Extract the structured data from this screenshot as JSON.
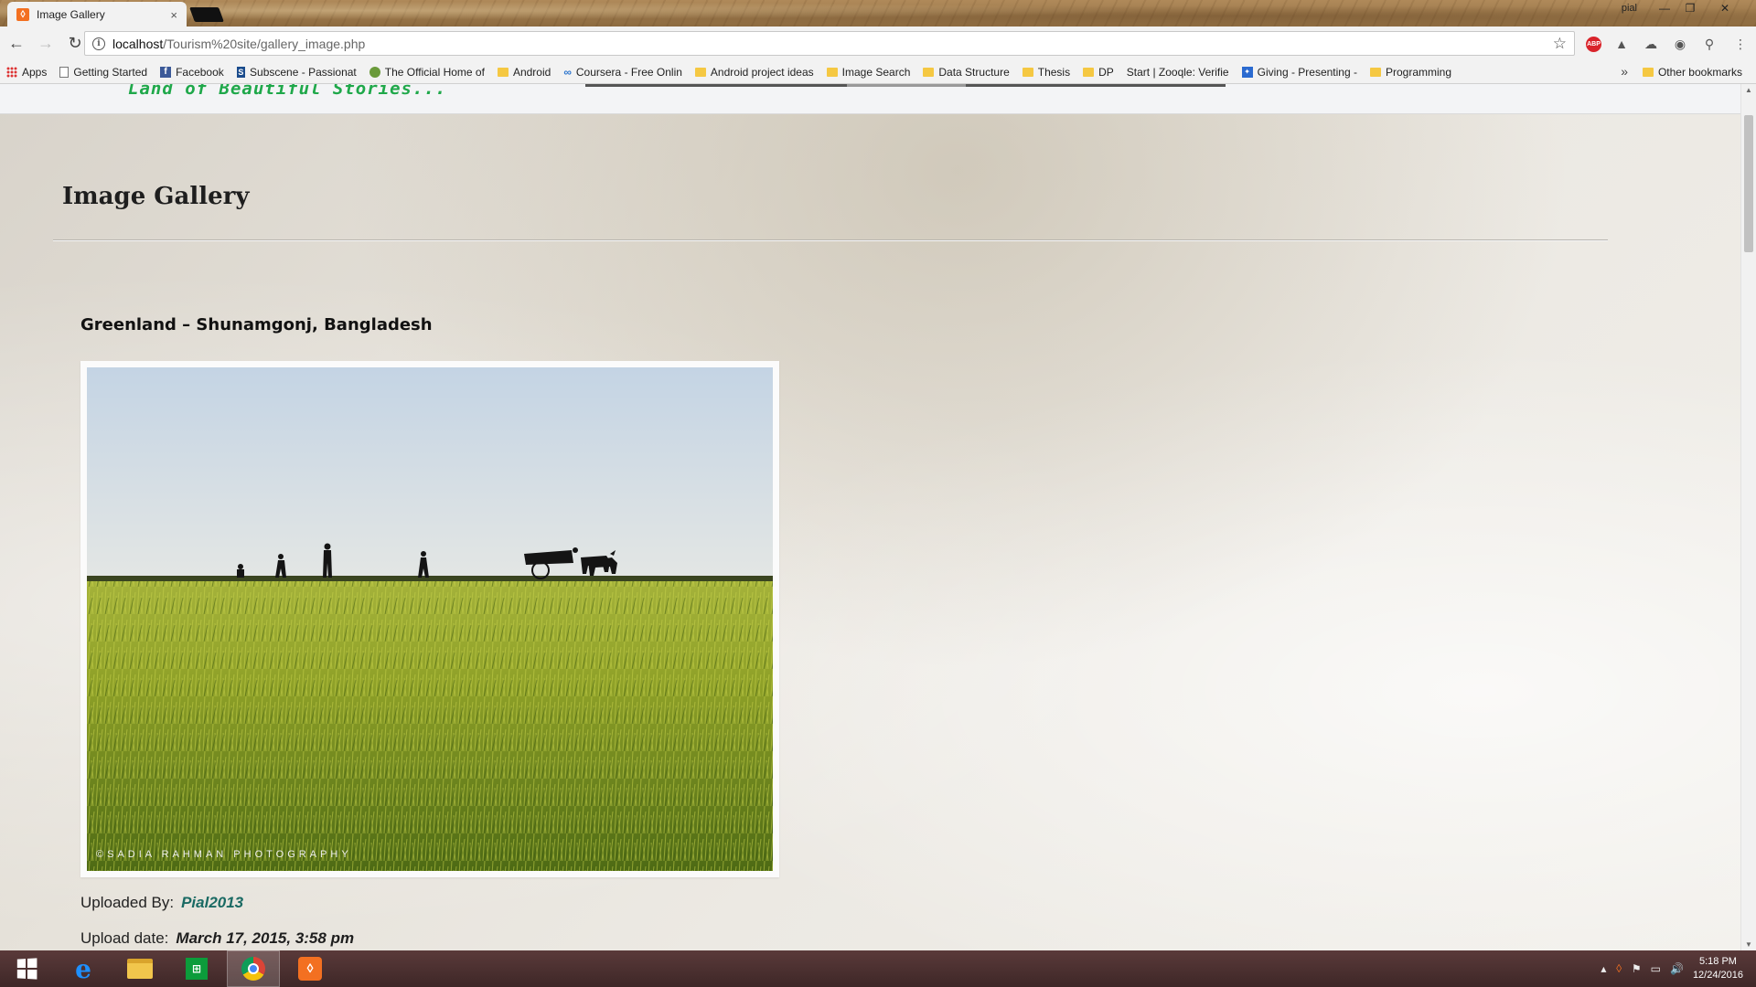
{
  "browser": {
    "tab_title": "Image Gallery",
    "tab_close": "×",
    "favicon_glyph": "ꕺ",
    "window_user": "pial",
    "window_controls": {
      "minimize": "—",
      "restore": "❐",
      "close": "✕"
    },
    "nav": {
      "back": "←",
      "forward": "→",
      "reload": "↻"
    },
    "url_host": "localhost",
    "url_path": "/Tourism%20site/gallery_image.php",
    "info_glyph": "i",
    "star_glyph": "☆",
    "extensions": [
      "ABP",
      "▲",
      "☁",
      "◉",
      "⚲",
      "⋮"
    ],
    "bookmarks": [
      {
        "label": "Apps",
        "icon": "grid"
      },
      {
        "label": "Getting Started",
        "icon": "page"
      },
      {
        "label": "Facebook",
        "icon": "fb"
      },
      {
        "label": "Subscene - Passionat",
        "icon": "subs"
      },
      {
        "label": "The Official Home of",
        "icon": "generic"
      },
      {
        "label": "Android",
        "icon": "folder"
      },
      {
        "label": "Coursera - Free Onlin",
        "icon": "coursera"
      },
      {
        "label": "Android project ideas",
        "icon": "folder"
      },
      {
        "label": "Image Search",
        "icon": "folder"
      },
      {
        "label": "Data Structure",
        "icon": "folder"
      },
      {
        "label": "Thesis",
        "icon": "folder"
      },
      {
        "label": "DP",
        "icon": "folder"
      },
      {
        "label": "Start | Zooqle: Verifie",
        "icon": "none"
      },
      {
        "label": "Giving - Presenting -",
        "icon": "giving"
      },
      {
        "label": "Programming",
        "icon": "folder"
      }
    ],
    "bookmarks_more": "»",
    "other_bookmarks": "Other bookmarks"
  },
  "page": {
    "tagline": "Land of Beautiful Stories...",
    "gallery_title": "Image Gallery",
    "image_title": "Greenland – Shunamgonj, Bangladesh",
    "photo_credit": "©SADIA RAHMAN PHOTOGRAPHY",
    "uploaded_by_label": "Uploaded By:",
    "uploaded_by_value": "Pial2013",
    "upload_date_label": "Upload date:",
    "upload_date_value": "March 17, 2015, 3:58 pm"
  },
  "colors": {
    "tagline": "#1fa84a",
    "uploader_link": "#1a6a63",
    "taskbar": "#4a3030"
  },
  "taskbar": {
    "items": [
      "windows-start",
      "internet-explorer",
      "file-explorer",
      "store",
      "chrome",
      "xampp"
    ],
    "tray_icons": [
      "▴",
      "ꕺ",
      "⚑",
      "▭",
      "🔊"
    ],
    "time": "5:18 PM",
    "date": "12/24/2016"
  }
}
